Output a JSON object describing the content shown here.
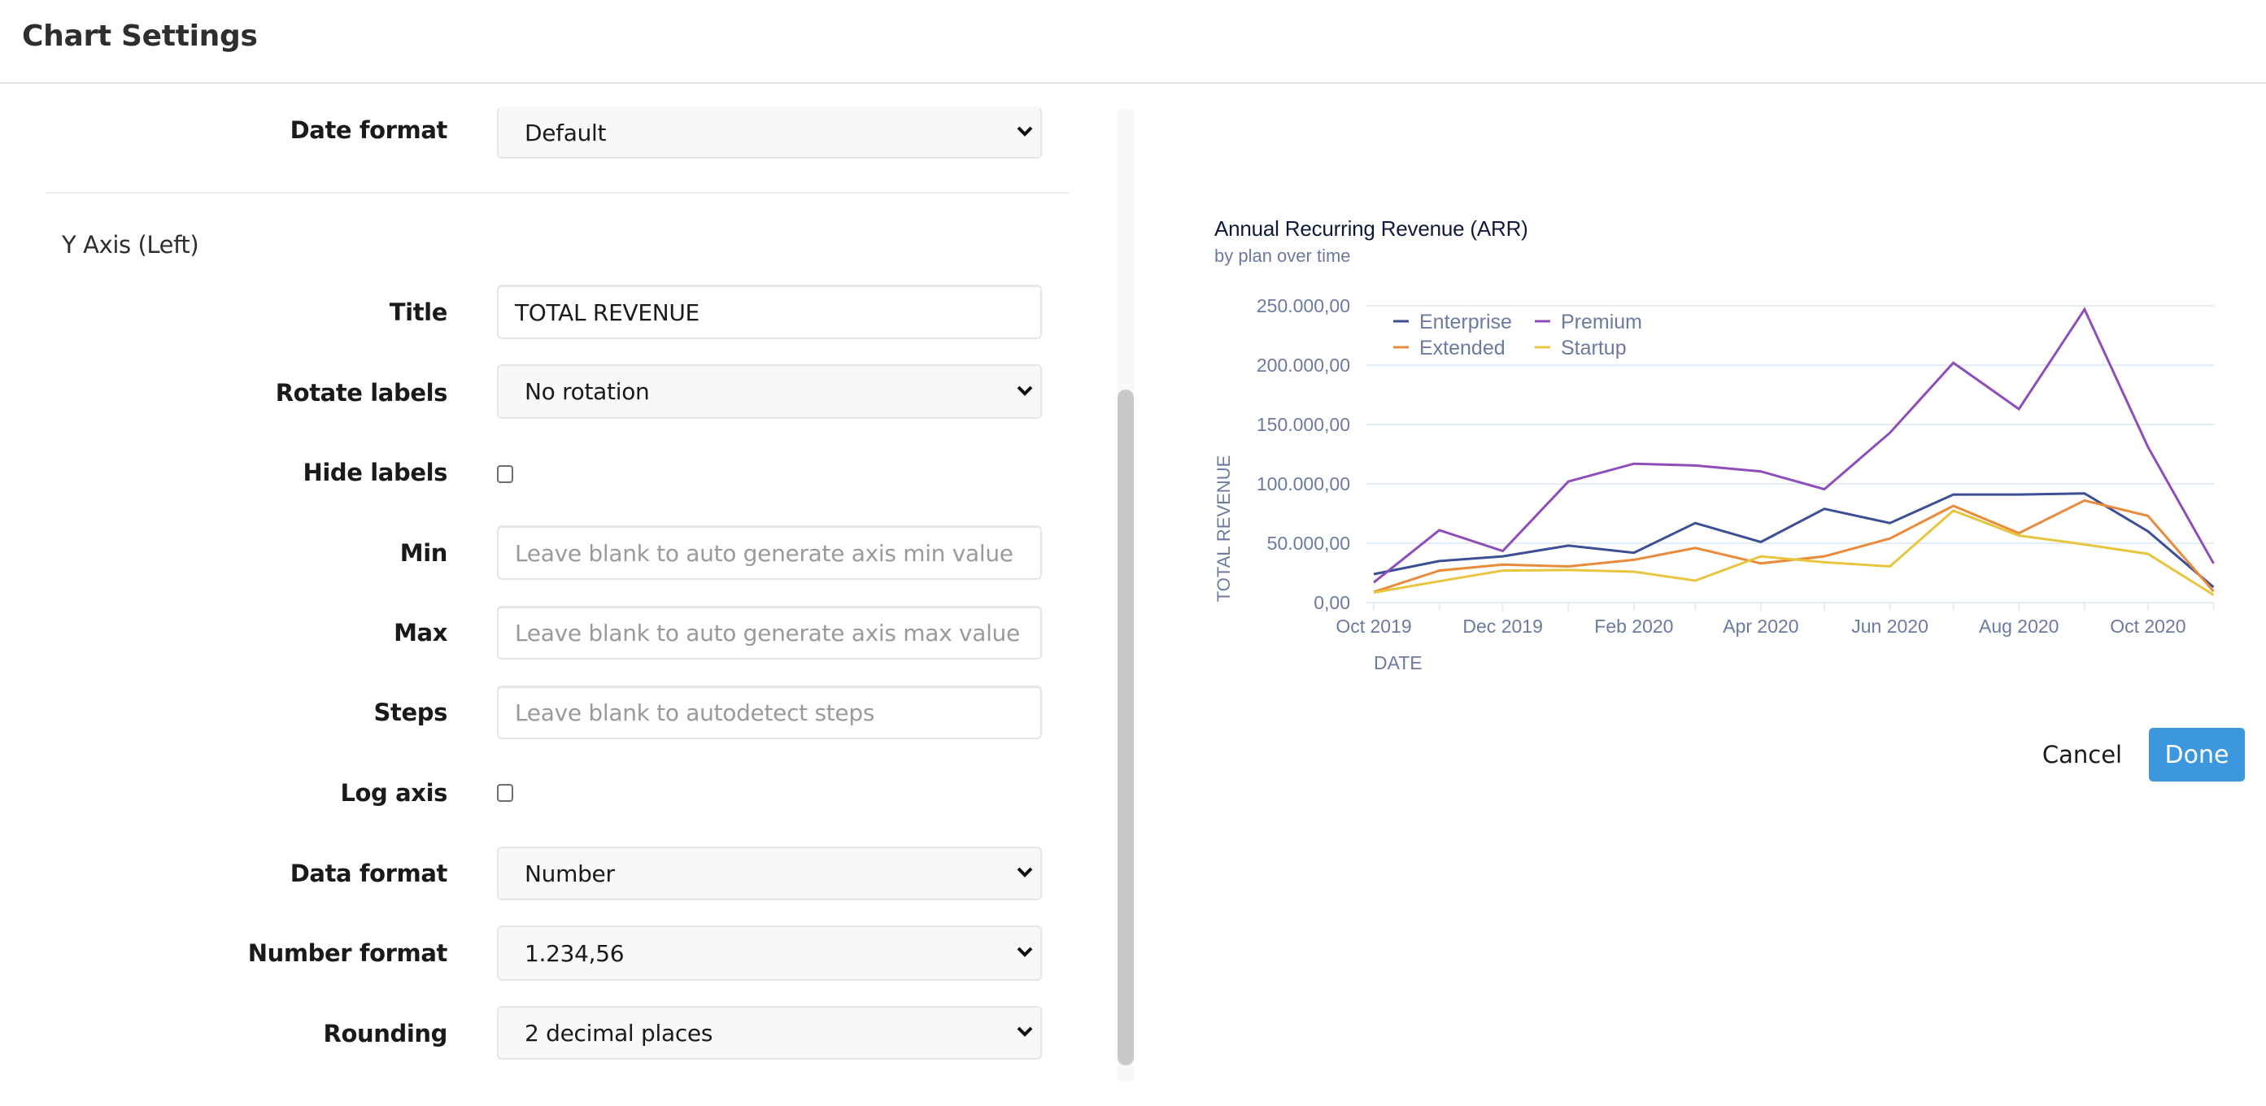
{
  "header": {
    "title": "Chart Settings"
  },
  "form": {
    "date_format": {
      "label": "Date format",
      "value": "Default"
    },
    "y_axis_section": {
      "title": "Y Axis (Left)"
    },
    "title_field": {
      "label": "Title",
      "value": "TOTAL REVENUE"
    },
    "rotate_labels": {
      "label": "Rotate labels",
      "value": "No rotation"
    },
    "hide_labels": {
      "label": "Hide labels",
      "checked": false
    },
    "min": {
      "label": "Min",
      "placeholder": "Leave blank to auto generate axis min value"
    },
    "max": {
      "label": "Max",
      "placeholder": "Leave blank to auto generate axis max value"
    },
    "steps": {
      "label": "Steps",
      "placeholder": "Leave blank to autodetect steps"
    },
    "log_axis": {
      "label": "Log axis",
      "checked": false
    },
    "data_format": {
      "label": "Data format",
      "value": "Number"
    },
    "number_format": {
      "label": "Number format",
      "value": "1.234,56"
    },
    "rounding": {
      "label": "Rounding",
      "value": "2 decimal places"
    }
  },
  "actions": {
    "cancel_label": "Cancel",
    "done_label": "Done",
    "done_color": "#3d97dc"
  },
  "chart_data": {
    "type": "line",
    "title": "Annual Recurring Revenue (ARR)",
    "subtitle": "by plan over time",
    "xlabel": "DATE",
    "ylabel": "TOTAL REVENUE",
    "ylim": [
      0,
      250000
    ],
    "yticks": [
      0,
      50000,
      100000,
      150000,
      200000,
      250000
    ],
    "ytick_labels": [
      "0,00",
      "50.000,00",
      "100.000,00",
      "150.000,00",
      "200.000,00",
      "250.000,00"
    ],
    "x": [
      "2019-10",
      "2019-11",
      "2019-12",
      "2020-01",
      "2020-02",
      "2020-03",
      "2020-04",
      "2020-05",
      "2020-06",
      "2020-07",
      "2020-08",
      "2020-09",
      "2020-10",
      "2020-11"
    ],
    "xtick_labels": [
      "Oct 2019",
      "Dec 2019",
      "Feb 2020",
      "Apr 2020",
      "Jun 2020",
      "Aug 2020",
      "Oct 2020"
    ],
    "xtick_label_positions": [
      "2019-10",
      "2019-12",
      "2020-02",
      "2020-04",
      "2020-06",
      "2020-08",
      "2020-10"
    ],
    "grid": true,
    "legend": "top-left",
    "series": [
      {
        "name": "Enterprise",
        "color": "#3d4f94",
        "values": [
          24000,
          35000,
          39000,
          48000,
          42000,
          67000,
          51000,
          79000,
          67000,
          91000,
          91000,
          92000,
          60000,
          13000
        ]
      },
      {
        "name": "Premium",
        "color": "#8e4db8",
        "values": [
          17000,
          61000,
          43500,
          102000,
          117000,
          115500,
          110500,
          95500,
          143000,
          202000,
          163000,
          247000,
          131000,
          33000
        ]
      },
      {
        "name": "Extended",
        "color": "#ea8b3c",
        "values": [
          9000,
          27000,
          32000,
          30500,
          36000,
          46000,
          33000,
          39000,
          54000,
          81500,
          58500,
          86000,
          73000,
          9500
        ]
      },
      {
        "name": "Startup",
        "color": "#e8c53e",
        "values": [
          8500,
          18000,
          27000,
          27500,
          26000,
          18500,
          39000,
          34000,
          30500,
          77500,
          56500,
          49000,
          41000,
          6500
        ]
      }
    ]
  }
}
